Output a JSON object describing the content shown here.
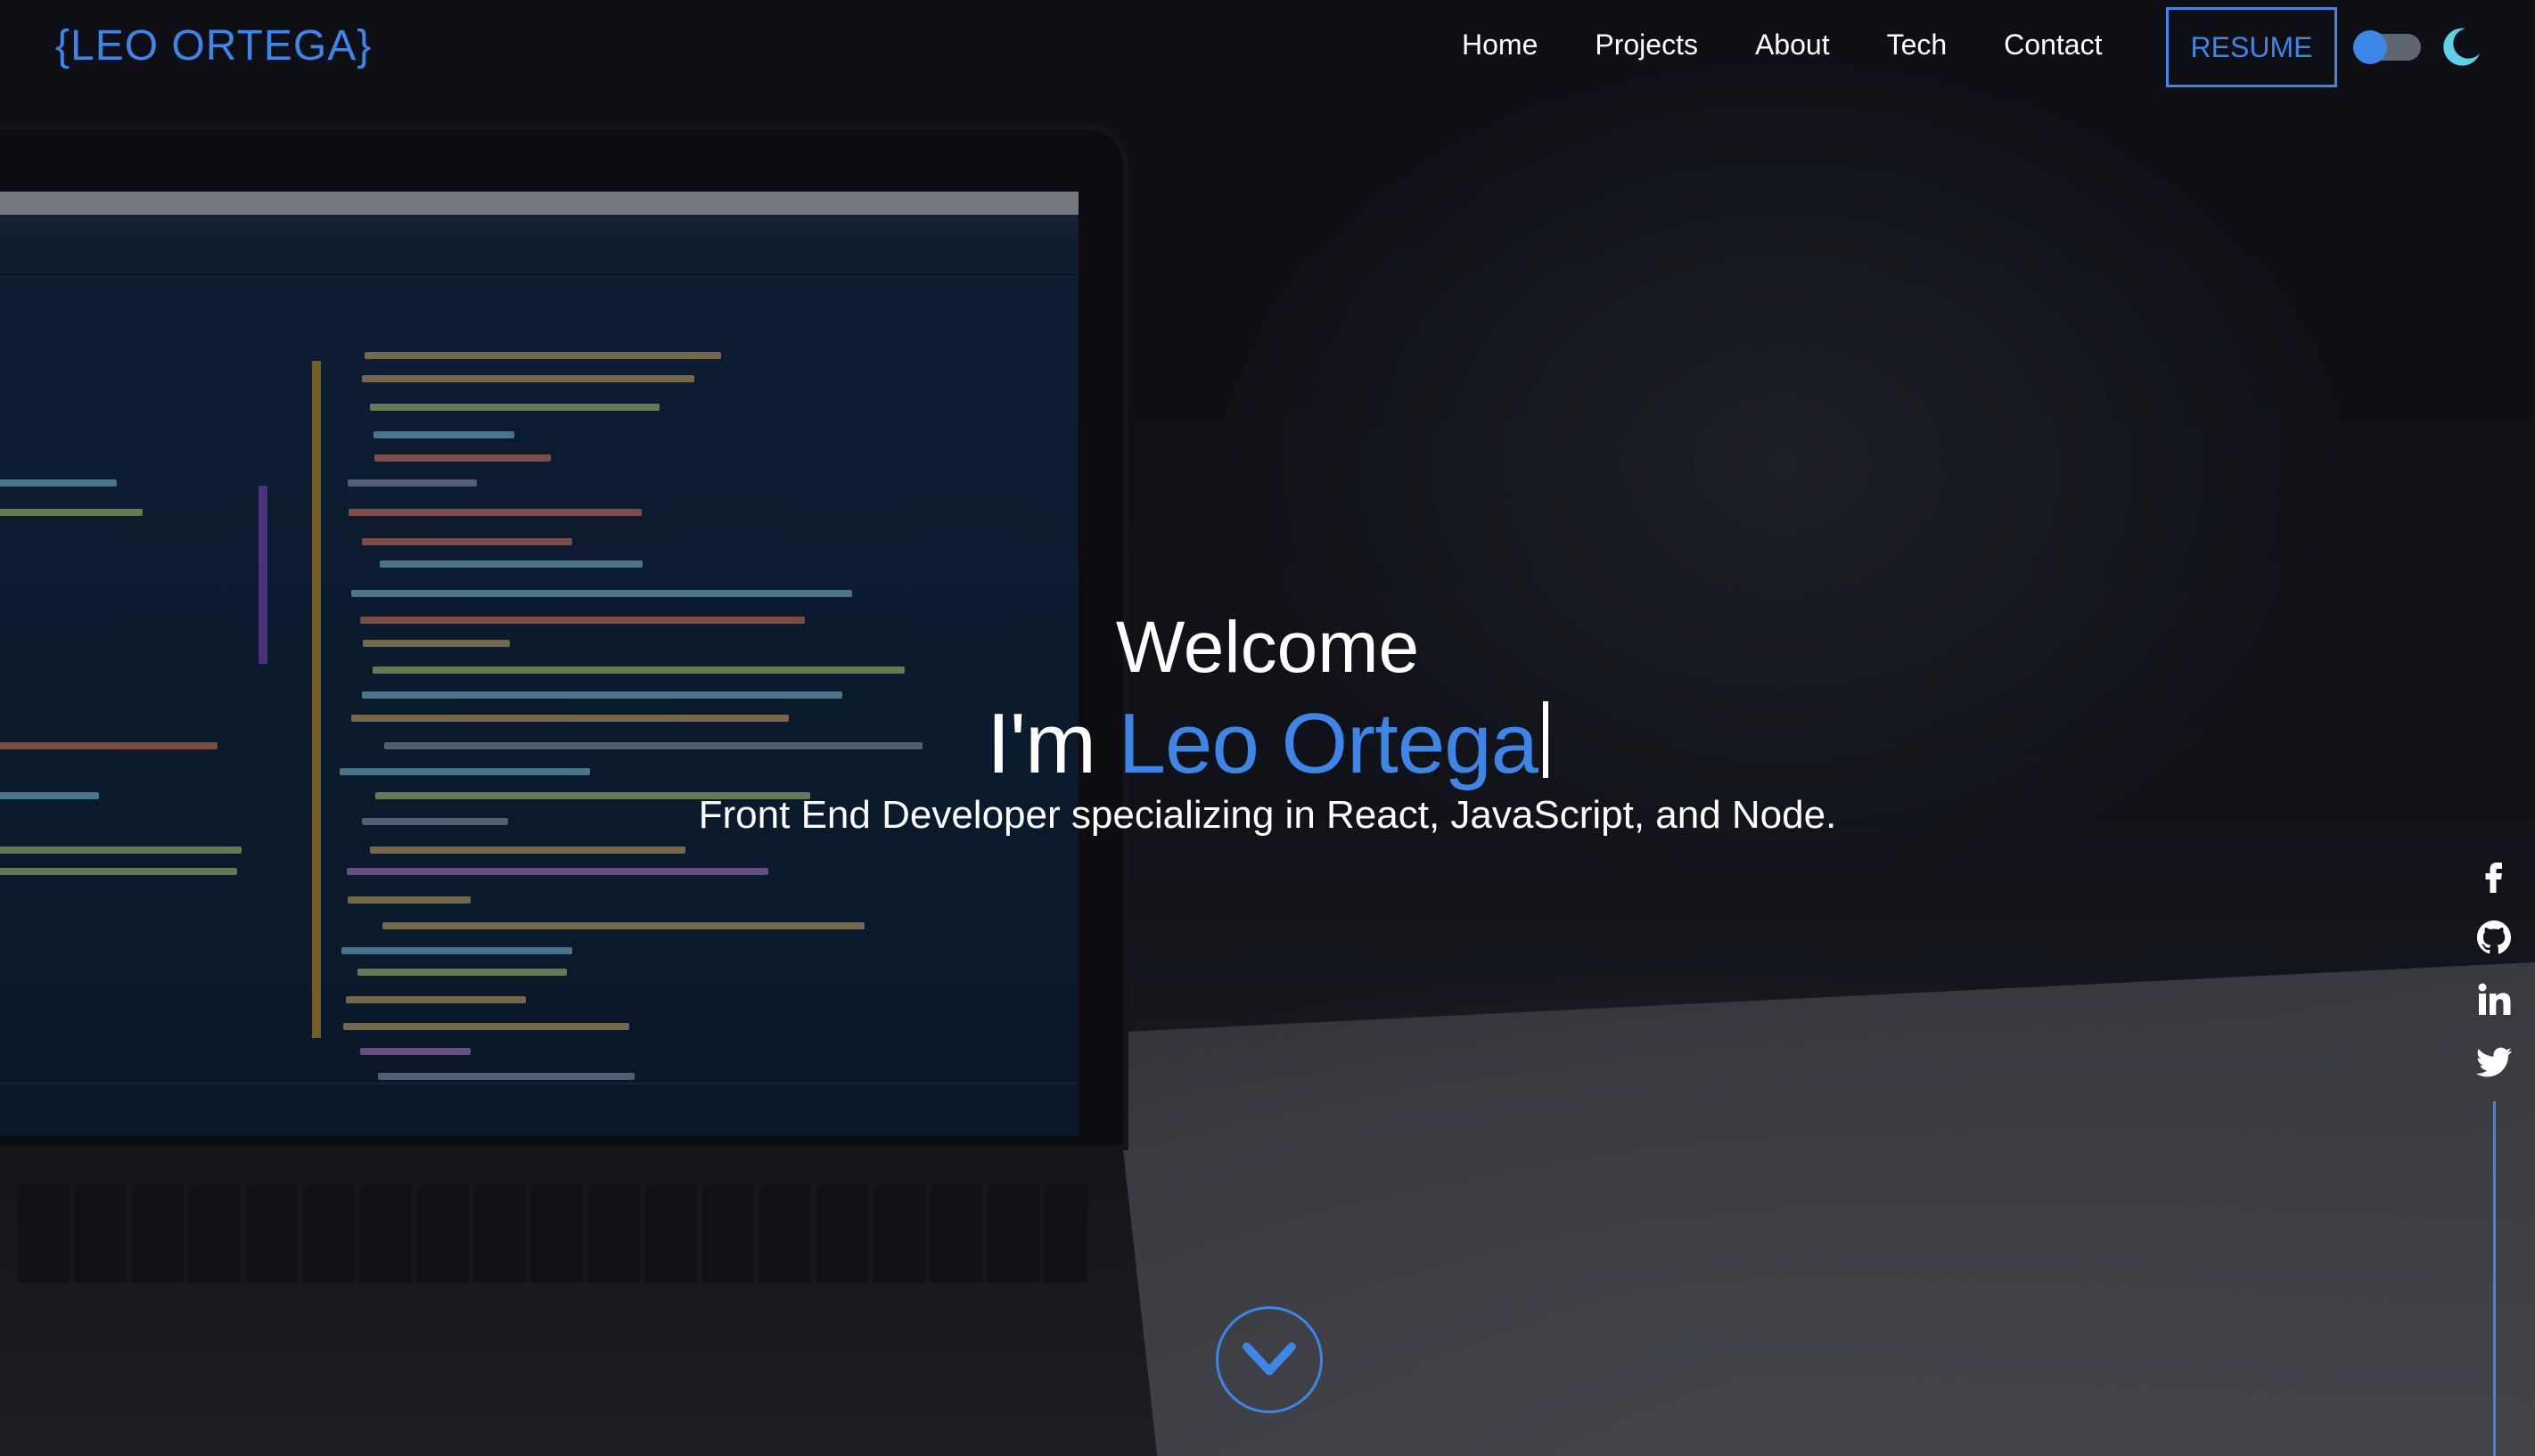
{
  "header": {
    "logo": "{LEO ORTEGA}",
    "nav": [
      "Home",
      "Projects",
      "About",
      "Tech",
      "Contact"
    ],
    "resume_label": "RESUME",
    "theme_toggle_on": true
  },
  "hero": {
    "welcome": "Welcome",
    "im_prefix": "I'm ",
    "name": "Leo Ortega",
    "tagline": "Front End Developer specializing in React, JavaScript, and Node."
  },
  "socials": [
    "facebook-icon",
    "github-icon",
    "linkedin-icon",
    "twitter-icon"
  ],
  "colors": {
    "accent": "#3d86e8",
    "text": "#ffffff",
    "background": "#0b0f17"
  }
}
